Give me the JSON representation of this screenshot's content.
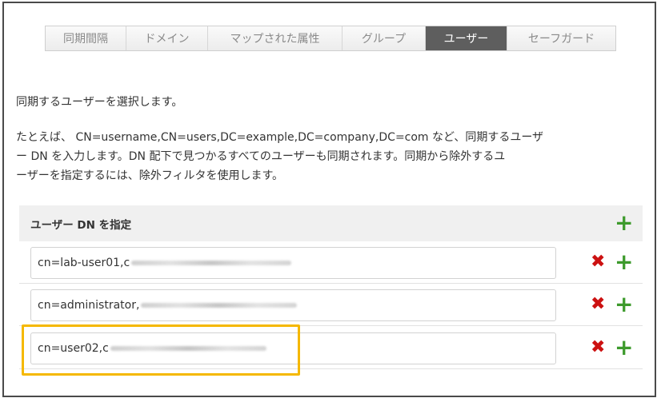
{
  "tabs": [
    {
      "label": "同期間隔",
      "active": false
    },
    {
      "label": "ドメイン",
      "active": false
    },
    {
      "label": "マップされた属性",
      "active": false
    },
    {
      "label": "グループ",
      "active": false
    },
    {
      "label": "ユーザー",
      "active": true
    },
    {
      "label": "セーフガード",
      "active": false
    }
  ],
  "intro_text": "同期するユーザーを選択します。",
  "description": {
    "line1": "たとえば、 CN=username,CN=users,DC=example,DC=company,DC=com など、同期するユーザ",
    "line2": "ー DN を入力します。DN 配下で見つかるすべてのユーザーも同期されます。同期から除外するユ",
    "line3": "ーザーを指定するには、除外フィルタを使用します。"
  },
  "section": {
    "title": "ユーザー DN を指定",
    "add_icon": "plus-icon"
  },
  "user_dns": [
    {
      "value": "cn=lab-user01,c"
    },
    {
      "value": "cn=administrator,"
    },
    {
      "value": "cn=user02,c"
    }
  ],
  "icons": {
    "remove": "✖",
    "add": "+"
  },
  "colors": {
    "highlight": "#f5b800",
    "remove": "#cc1111",
    "add": "#3d9a2c",
    "active_tab": "#5e5e5e"
  }
}
